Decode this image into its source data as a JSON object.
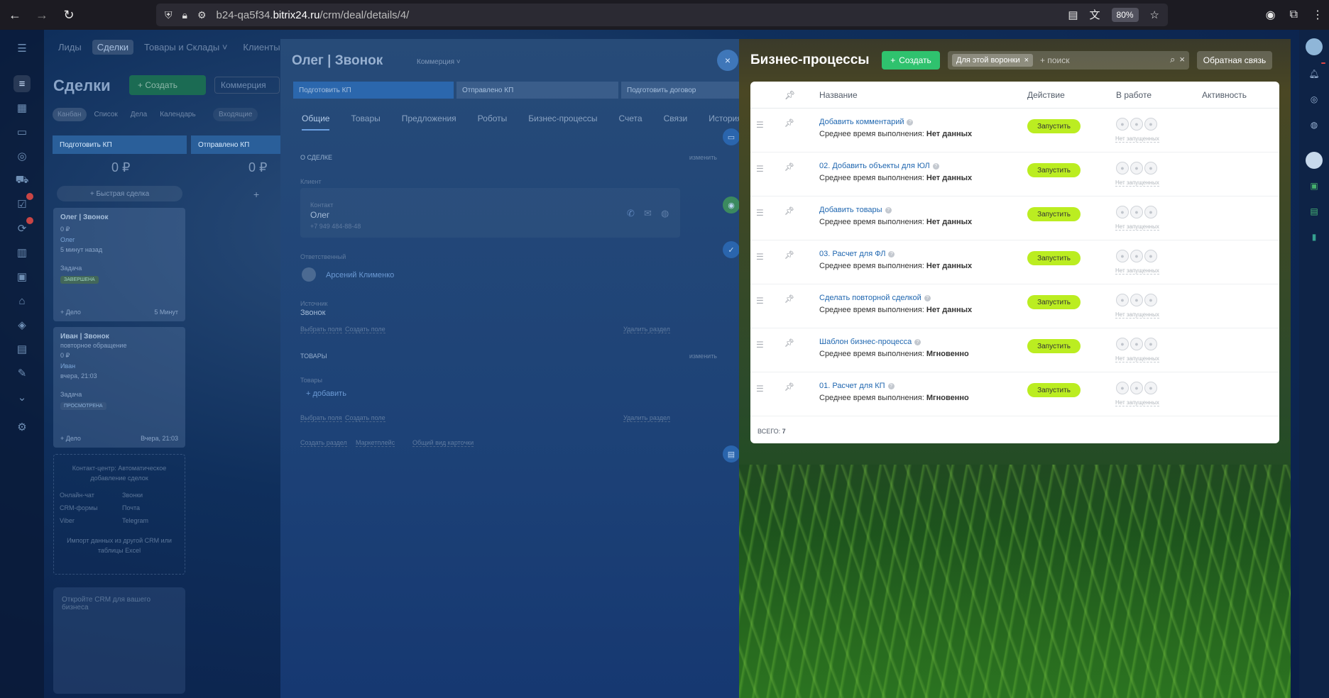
{
  "browser": {
    "url_prefix": "b24-qa5f34.",
    "url_host": "bitrix24.ru",
    "url_path": "/crm/deal/details/4/",
    "zoom": "80%"
  },
  "top_nav": {
    "items": [
      "Лиды",
      "Сделки",
      "Товары и Склады ˅",
      "Клиенты ˅"
    ]
  },
  "page": {
    "title": "Сделки",
    "create_label": "+ Создать",
    "category_label": "Коммерция",
    "view_tabs": [
      "Канбан",
      "Список",
      "Дела",
      "Календарь"
    ],
    "inbox_label": "Входящие"
  },
  "kanban": {
    "columns": [
      {
        "title": "Подготовить КП",
        "sum": "0 ₽"
      },
      {
        "title": "Отправлено КП",
        "sum": "0 ₽"
      }
    ],
    "quick_deal": "+ Быстрая сделка",
    "cards": [
      {
        "title": "Олег | Звонок",
        "sum": "0 ₽",
        "contact": "Олег",
        "time": "5 минут назад",
        "task_label": "Задача",
        "badge": "ЗАВЕРШЕНА",
        "add": "+ Дело",
        "footer_time": "5 Минут"
      },
      {
        "title": "Иван | Звонок",
        "subtitle": "повторное обращение",
        "sum": "0 ₽",
        "contact": "Иван",
        "time": "вчера, 21:03",
        "task_label": "Задача",
        "badge": "ПРОСМОТРЕНА",
        "add": "+ Дело",
        "footer_time": "Вчера, 21:03"
      }
    ],
    "contact_center": {
      "title": "Контакт-центр: Автоматическое добавление сделок",
      "channels": [
        "Онлайн-чат",
        "Звонки",
        "CRM-формы",
        "Почта",
        "Viber",
        "Telegram"
      ],
      "import_text": "Импорт данных из другой CRM или таблицы Excel"
    },
    "promo": "Откройте CRM для вашего бизнеса"
  },
  "deal": {
    "title": "Олег | Звонок",
    "category": "Коммерция ˅",
    "stages": [
      "Подготовить КП",
      "Отправлено КП",
      "Подготовить договор"
    ],
    "tabs": [
      "Общие",
      "Товары",
      "Предложения",
      "Роботы",
      "Бизнес-процессы",
      "Счета",
      "Связи",
      "История"
    ],
    "about_head": "О СДЕЛКЕ",
    "edit": "изменить",
    "client_label": "Клиент",
    "contact_label": "Контакт",
    "contact_name": "Олег",
    "contact_phone": "+7 949 484-88-48",
    "responsible_label": "Ответственный",
    "responsible_name": "Арсений Клименко",
    "source_label": "Источник",
    "source_value": "Звонок",
    "select_fields": "Выбрать поля",
    "create_field": "Создать поле",
    "delete_section": "Удалить раздел",
    "goods_head": "ТОВАРЫ",
    "goods_label": "Товары",
    "goods_add": "+ добавить",
    "create_section": "Создать раздел",
    "marketplace": "Маркетплейс",
    "common_view": "Общий вид карточки"
  },
  "bp": {
    "title": "Бизнес-процессы",
    "create_label": "Создать",
    "filter_chip": "Для этой воронки",
    "search_placeholder": "+ поиск",
    "feedback_label": "Обратная связь",
    "columns": {
      "name": "Название",
      "action": "Действие",
      "in_work": "В работе",
      "activity": "Активность"
    },
    "time_label": "Среднее время выполнения:",
    "run_label": "Запустить",
    "none_label": "Нет запущенных",
    "rows": [
      {
        "name": "Добавить комментарий",
        "time": "Нет данных"
      },
      {
        "name": "02. Добавить объекты для ЮЛ",
        "time": "Нет данных"
      },
      {
        "name": "Добавить товары",
        "time": "Нет данных"
      },
      {
        "name": "03. Расчет для ФЛ",
        "time": "Нет данных"
      },
      {
        "name": "Сделать повторной сделкой",
        "time": "Нет данных"
      },
      {
        "name": "Шаблон бизнес-процесса",
        "time": "Мгновенно"
      },
      {
        "name": "01. Расчет для КП",
        "time": "Мгновенно"
      }
    ],
    "total_label": "ВСЕГО:",
    "total_value": "7"
  }
}
